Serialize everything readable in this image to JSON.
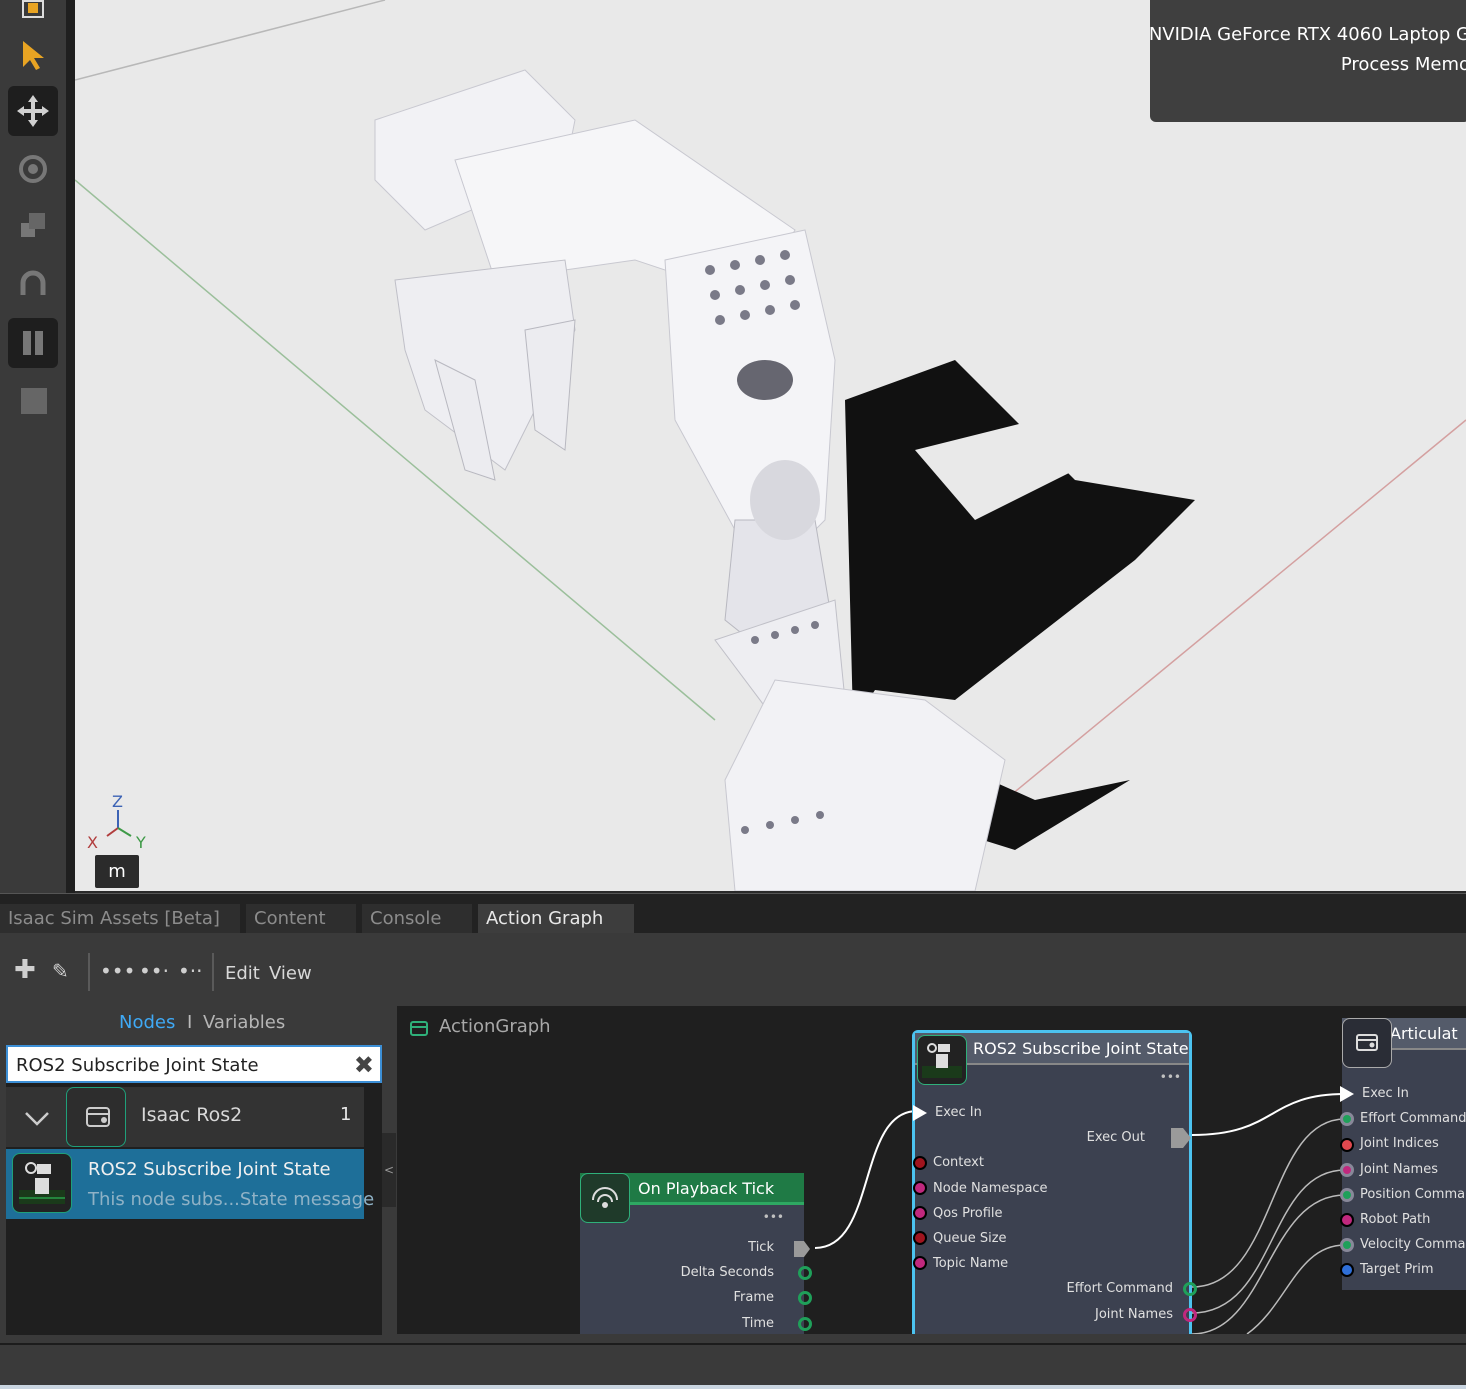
{
  "viewport": {
    "gpu_label": "NVIDIA GeForce RTX 4060 Laptop G",
    "memory_label": "Process Memo",
    "axis_z": "Z",
    "axis_x": "X",
    "axis_y": "Y",
    "unit": "m"
  },
  "tabs": [
    {
      "label": "Isaac Sim Assets [Beta]"
    },
    {
      "label": "Content"
    },
    {
      "label": "Console"
    },
    {
      "label": "Action Graph"
    }
  ],
  "toolbar": {
    "edit_label": "Edit",
    "view_label": "View"
  },
  "library": {
    "nodes_tab": "Nodes",
    "separator": "I",
    "variables_tab": "Variables",
    "search_value": "ROS2 Subscribe Joint State",
    "category": {
      "label": "Isaac Ros2",
      "count": "1"
    },
    "item": {
      "title": "ROS2 Subscribe Joint State",
      "description": "This node subs...State message"
    }
  },
  "graph": {
    "title": "ActionGraph",
    "nodes": {
      "tick": {
        "title": "On Playback Tick",
        "outputs": [
          "Tick",
          "Delta Seconds",
          "Frame",
          "Time"
        ]
      },
      "subscribe": {
        "title": "ROS2 Subscribe Joint State",
        "exec_in": "Exec In",
        "exec_out": "Exec Out",
        "inputs": [
          "Context",
          "Node Namespace",
          "Qos Profile",
          "Queue Size",
          "Topic Name"
        ],
        "outputs": [
          "Effort Command",
          "Joint Names"
        ]
      },
      "articulation": {
        "title": "Articulat",
        "inputs": [
          "Exec In",
          "Effort Command",
          "Joint Indices",
          "Joint Names",
          "Position Commar",
          "Robot Path",
          "Velocity Comman",
          "Target Prim"
        ]
      }
    }
  },
  "colors": {
    "accent_blue": "#3fa9f5",
    "selected_node_border": "#4cc3f0",
    "tick_header": "#1f7a45",
    "port_green": "#1fa05a",
    "port_magenta": "#c0287e",
    "port_red": "#a0141e",
    "port_blue": "#2f6fd8"
  }
}
